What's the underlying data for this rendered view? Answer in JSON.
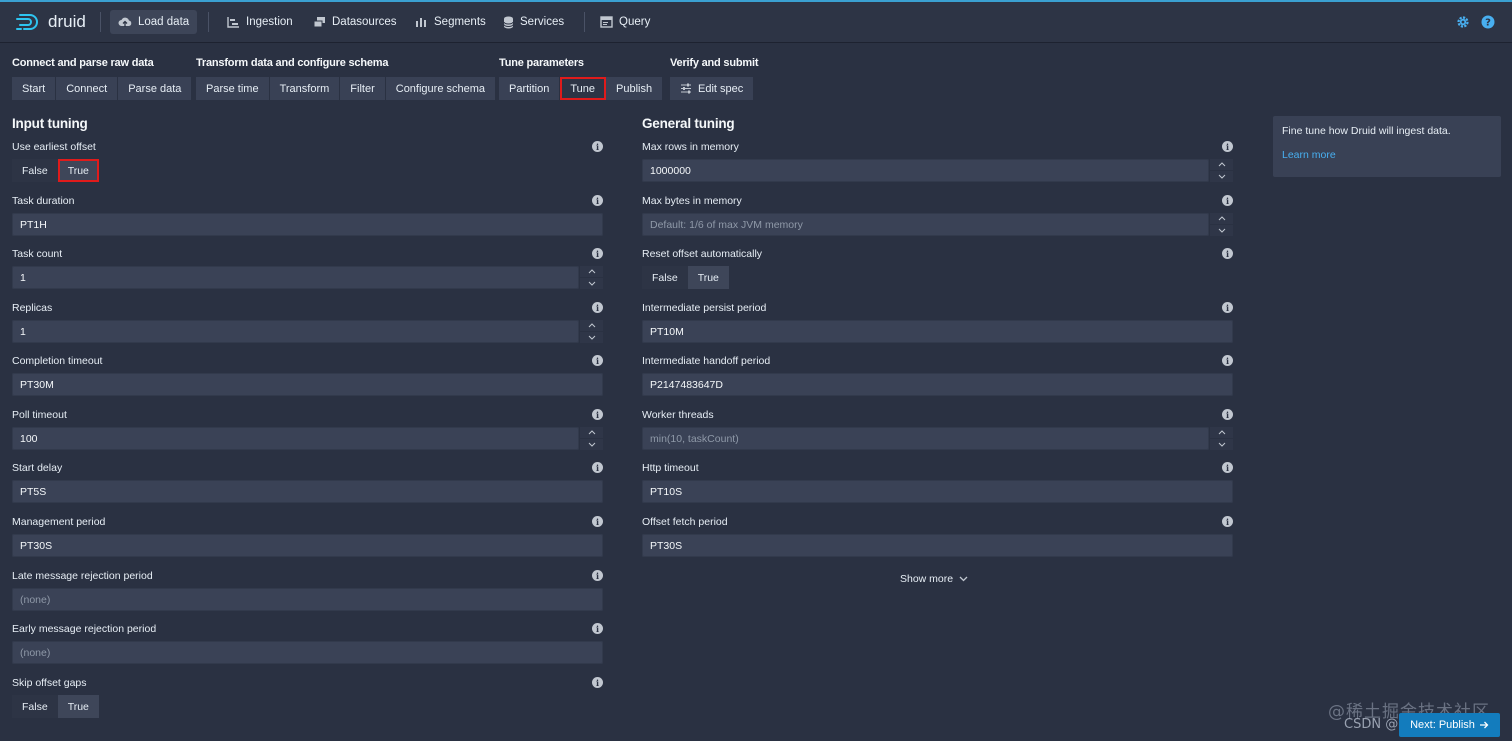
{
  "header": {
    "brand": "druid",
    "nav": [
      {
        "label": "Load data",
        "icon": "cloud-upload-icon"
      },
      {
        "label": "Ingestion",
        "icon": "gantt-chart-icon"
      },
      {
        "label": "Datasources",
        "icon": "multi-select-icon"
      },
      {
        "label": "Segments",
        "icon": "stacked-chart-icon"
      },
      {
        "label": "Services",
        "icon": "database-icon"
      },
      {
        "label": "Query",
        "icon": "application-icon"
      }
    ],
    "right_icons": [
      "gear-icon",
      "help-icon"
    ]
  },
  "steps": [
    {
      "title": "Connect and parse raw data",
      "buttons": [
        "Start",
        "Connect",
        "Parse data"
      ]
    },
    {
      "title": "Transform data and configure schema",
      "buttons": [
        "Parse time",
        "Transform",
        "Filter",
        "Configure schema"
      ]
    },
    {
      "title": "Tune parameters",
      "buttons": [
        "Partition",
        "Tune",
        "Publish"
      ],
      "active": "Tune"
    },
    {
      "title": "Verify and submit",
      "buttons": [
        "Edit spec"
      ]
    }
  ],
  "input_tuning": {
    "title": "Input tuning",
    "use_earliest_offset": {
      "label": "Use earliest offset",
      "options": [
        "False",
        "True"
      ],
      "selected": "True"
    },
    "task_duration": {
      "label": "Task duration",
      "value": "PT1H"
    },
    "task_count": {
      "label": "Task count",
      "value": "1"
    },
    "replicas": {
      "label": "Replicas",
      "value": "1"
    },
    "completion_timeout": {
      "label": "Completion timeout",
      "value": "PT30M"
    },
    "poll_timeout": {
      "label": "Poll timeout",
      "value": "100"
    },
    "start_delay": {
      "label": "Start delay",
      "value": "PT5S"
    },
    "management_period": {
      "label": "Management period",
      "value": "PT30S"
    },
    "late_message_rejection_period": {
      "label": "Late message rejection period",
      "placeholder": "(none)"
    },
    "early_message_rejection_period": {
      "label": "Early message rejection period",
      "placeholder": "(none)"
    },
    "skip_offset_gaps": {
      "label": "Skip offset gaps",
      "options": [
        "False",
        "True"
      ],
      "selected": "True"
    }
  },
  "general_tuning": {
    "title": "General tuning",
    "max_rows_in_memory": {
      "label": "Max rows in memory",
      "value": "1000000"
    },
    "max_bytes_in_memory": {
      "label": "Max bytes in memory",
      "placeholder": "Default: 1/6 of max JVM memory"
    },
    "reset_offset_automatically": {
      "label": "Reset offset automatically",
      "options": [
        "False",
        "True"
      ],
      "selected": "True"
    },
    "intermediate_persist_period": {
      "label": "Intermediate persist period",
      "value": "PT10M"
    },
    "intermediate_handoff_period": {
      "label": "Intermediate handoff period",
      "value": "P2147483647D"
    },
    "worker_threads": {
      "label": "Worker threads",
      "placeholder": "min(10, taskCount)"
    },
    "http_timeout": {
      "label": "Http timeout",
      "value": "PT10S"
    },
    "offset_fetch_period": {
      "label": "Offset fetch period",
      "value": "PT30S"
    },
    "show_more": "Show more"
  },
  "help_card": {
    "text": "Fine tune how Druid will ingest data.",
    "link": "Learn more"
  },
  "footer": {
    "watermark": "@稀土掘金技术社区",
    "watermark2": "CSDN @",
    "next_button": "Next: Publish"
  },
  "colors": {
    "background": "#2a3142",
    "accent": "#137cbd",
    "highlight": "#e01b1b",
    "link": "#48aff0"
  }
}
